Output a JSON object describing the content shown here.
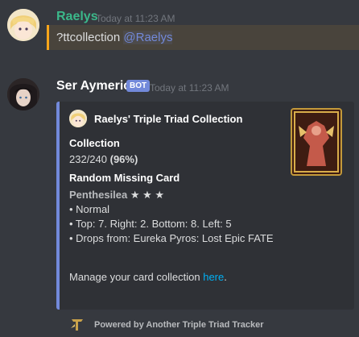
{
  "messages": [
    {
      "username": "Raelys",
      "timestamp": "Today at 11:23 AM",
      "content_text": "?ttcollection",
      "mention": "@Raelys"
    },
    {
      "username": "Ser Aymeric",
      "bot_tag": "BOT",
      "timestamp": "Today at 11:23 AM",
      "embed": {
        "author": "Raelys' Triple Triad Collection",
        "collection_title": "Collection",
        "collection_count": "232/240",
        "collection_pct": "(96%)",
        "random_title": "Random Missing Card",
        "card_name": "Penthesilea",
        "card_stars": "★ ★ ★",
        "lines": [
          "• Normal",
          "• Top: 7. Right: 2. Bottom: 8. Left: 5",
          "• Drops from: Eureka Pyros: Lost Epic FATE"
        ],
        "manage_text": "Manage your card collection",
        "manage_link": "here",
        "manage_end": ".",
        "footer": "Powered by Another Triple Triad Tracker"
      }
    }
  ],
  "colors": {
    "background": "#36393f",
    "embed_bg": "#2f3136",
    "embed_border": "#7289da",
    "mention_highlight": "#faa61a",
    "link": "#00b0f4"
  }
}
